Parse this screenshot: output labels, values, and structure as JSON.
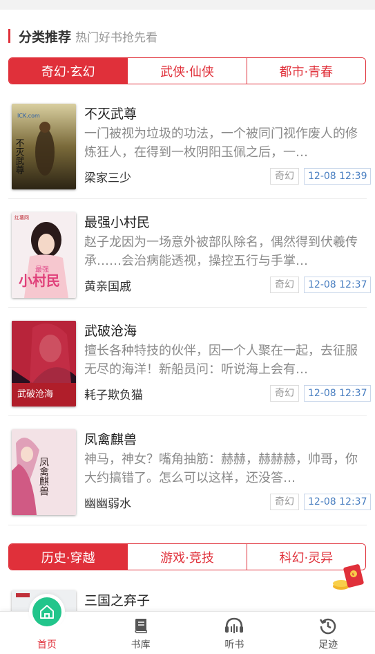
{
  "section": {
    "title": "分类推荐",
    "subtitle": "热门好书抢先看"
  },
  "tabs_group1": [
    {
      "label": "奇幻·玄幻",
      "active": true
    },
    {
      "label": "武侠·仙侠",
      "active": false
    },
    {
      "label": "都市·青春",
      "active": false
    }
  ],
  "books": [
    {
      "title": "不灭武尊",
      "desc": "一门被视为垃圾的功法，一个被同门视作废人的修炼狂人，在得到一枚阴阳玉佩之后，一…",
      "author": "梁家三少",
      "category": "奇幻",
      "time": "12-08 12:39"
    },
    {
      "title": "最强小村民",
      "desc": "赵子龙因为一场意外被部队除名，偶然得到伏羲传承……会治病能透视，操控五行与手掌…",
      "author": "黄亲国戚",
      "category": "奇幻",
      "time": "12-08 12:37"
    },
    {
      "title": "武破沧海",
      "desc": "擅长各种特技的伙伴，因一个人聚在一起，去征服无尽的海洋！新船员问：听说海上会有…",
      "author": "耗子欺负猫",
      "category": "奇幻",
      "time": "12-08 12:37"
    },
    {
      "title": "凤禽麒兽",
      "desc": "神马，神女？嘴角抽筋：赫赫，赫赫赫，帅哥，你大约搞错了。怎么可以这样，还没答…",
      "author": "幽幽弱水",
      "category": "奇幻",
      "time": "12-08 12:37"
    }
  ],
  "covers": {
    "book1": {
      "line1": "不灭武尊"
    },
    "book2": {
      "top": "红薯网",
      "small": "最强",
      "big": "小村民"
    },
    "book3": {
      "text": "武破沧海"
    },
    "book4": {
      "text": "凤禽麒兽"
    }
  },
  "tabs_group2": [
    {
      "label": "历史·穿越",
      "active": true
    },
    {
      "label": "游戏·竞技",
      "active": false
    },
    {
      "label": "科幻·灵异",
      "active": false
    }
  ],
  "book5": {
    "title": "三国之弃子"
  },
  "nav": [
    {
      "label": "首页",
      "icon": "home-icon",
      "active": true
    },
    {
      "label": "书库",
      "icon": "library-icon",
      "active": false
    },
    {
      "label": "听书",
      "icon": "headphones-icon",
      "active": false
    },
    {
      "label": "足迹",
      "icon": "history-icon",
      "active": false
    }
  ],
  "colors": {
    "accent": "#e0303a",
    "home_green": "#22c58b",
    "time_blue": "#4a7fc1"
  }
}
